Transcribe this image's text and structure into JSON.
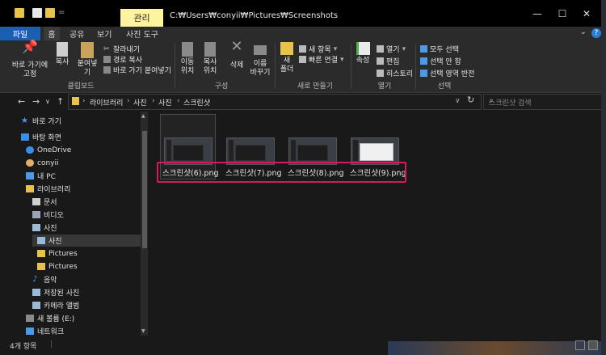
{
  "titlebar": {
    "context_tab": "관리",
    "path": "C:₩Users₩conyii₩Pictures₩Screenshots",
    "qa_sep": "="
  },
  "ribbon_tabs": {
    "file": "파일",
    "home": "홈",
    "share": "공유",
    "view": "보기",
    "picture_tools": "사진 도구",
    "help": "?",
    "collapse": "⌄"
  },
  "ribbon": {
    "pin": "바로 가기에\n고정",
    "copy": "복사",
    "paste": "붙여넣기",
    "cut": "잘라내기",
    "copy_path": "경로 복사",
    "paste_shortcut": "바로 가기 붙여넣기",
    "clipboard_label": "클립보드",
    "move_to": "이동\n위치",
    "copy_to": "복사\n위치",
    "delete": "삭제",
    "rename": "이름\n바꾸기",
    "organize_label": "구성",
    "new_folder": "새\n폴더",
    "new_item": "새 항목",
    "easy_access": "빠른 연결",
    "new_label": "새로 만들기",
    "properties": "속성",
    "open": "열기",
    "edit": "편집",
    "history": "히스토리",
    "open_label": "열기",
    "select_all": "모두 선택",
    "select_none": "선택 안 함",
    "invert_selection": "선택 영역 반전",
    "select_label": "선택"
  },
  "address": {
    "seg1": "라이브러리",
    "seg2": "사진",
    "seg3": "사진",
    "seg4": "스크린샷",
    "search_placeholder": "스크린샷 검색"
  },
  "navpane": {
    "items": [
      {
        "label": "바로 가기"
      },
      {
        "label": "바탕 화면"
      },
      {
        "label": "OneDrive"
      },
      {
        "label": "conyii"
      },
      {
        "label": "내 PC"
      },
      {
        "label": "라이브러리"
      },
      {
        "label": "문서"
      },
      {
        "label": "비디오"
      },
      {
        "label": "사진"
      },
      {
        "label": "사진"
      },
      {
        "label": "Pictures"
      },
      {
        "label": "Pictures"
      },
      {
        "label": "음악"
      },
      {
        "label": "저장된 사진"
      },
      {
        "label": "카메라 앨범"
      },
      {
        "label": "새 볼륨 (E:)"
      },
      {
        "label": "네트워크"
      }
    ]
  },
  "files": [
    {
      "name": "스크린샷(6).png"
    },
    {
      "name": "스크린샷(7).png"
    },
    {
      "name": "스크린샷(8).png"
    },
    {
      "name": "스크린샷(9).png"
    }
  ],
  "status": {
    "count": "4개 항목"
  },
  "colors": {
    "accent": "#1a5fb4",
    "highlight": "#d61a5e",
    "folder": "#e8c24a"
  }
}
